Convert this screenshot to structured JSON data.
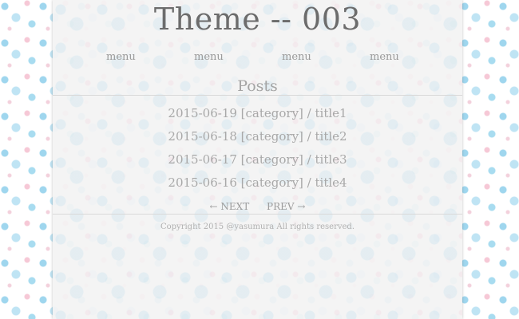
{
  "site": {
    "title": "Theme -- 003"
  },
  "nav": {
    "items": [
      {
        "label": "menu"
      },
      {
        "label": "menu"
      },
      {
        "label": "menu"
      },
      {
        "label": "menu"
      }
    ]
  },
  "posts": {
    "heading": "Posts",
    "items": [
      {
        "text": "2015-06-19 [category] / title1"
      },
      {
        "text": "2015-06-18 [category] / title2"
      },
      {
        "text": "2015-06-17 [category] / title3"
      },
      {
        "text": "2015-06-16 [category] / title4"
      }
    ]
  },
  "pager": {
    "next_label": "← NEXT",
    "prev_label": "PREV →"
  },
  "footer": {
    "copyright": "Copyright 2015 @yasumura All rights reserved."
  },
  "colors": {
    "panel": "#f3f3f3",
    "title": "#6c6c6c",
    "text": "#a8a8a8",
    "pattern_blue": "#9fd6ee",
    "pattern_pink": "#f6c8d6"
  }
}
